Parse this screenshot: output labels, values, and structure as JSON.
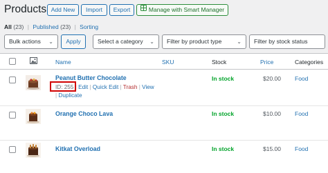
{
  "page": {
    "title": "Products",
    "buttons": {
      "add_new": "Add New",
      "import": "Import",
      "export": "Export",
      "smart_manager": "Manage with Smart Manager"
    }
  },
  "views": {
    "all_label": "All",
    "all_count": "(23)",
    "published_label": "Published",
    "published_count": "(23)",
    "sorting_label": "Sorting",
    "separator": "|"
  },
  "filters": {
    "bulk_actions": "Bulk actions",
    "apply": "Apply",
    "category": "Select a category",
    "product_type": "Filter by product type",
    "stock_status": "Filter by stock status"
  },
  "columns": {
    "name": "Name",
    "sku": "SKU",
    "stock": "Stock",
    "price": "Price",
    "categories": "Categories"
  },
  "rows": [
    {
      "name": "Peanut Butter Chocolate",
      "id_label": "ID: 255",
      "actions": {
        "edit": "Edit",
        "quick_edit": "Quick Edit",
        "trash": "Trash",
        "view": "View",
        "duplicate": "Duplicate"
      },
      "stock": "In stock",
      "price": "$20.00",
      "category": "Food"
    },
    {
      "name": "Orange Choco Lava",
      "stock": "In stock",
      "price": "$10.00",
      "category": "Food"
    },
    {
      "name": "Kitkat Overload",
      "stock": "In stock",
      "price": "$15.00",
      "category": "Food"
    }
  ],
  "colors": {
    "link": "#2271b1",
    "in_stock": "#00a32a",
    "trash": "#b32d2e",
    "highlight_box": "#d00000",
    "smart_manager": "#1e6e2b"
  },
  "icons": {
    "thumbnail_header": "image-icon",
    "smart_manager": "grid-icon",
    "dropdown": "chevron-down-icon"
  }
}
